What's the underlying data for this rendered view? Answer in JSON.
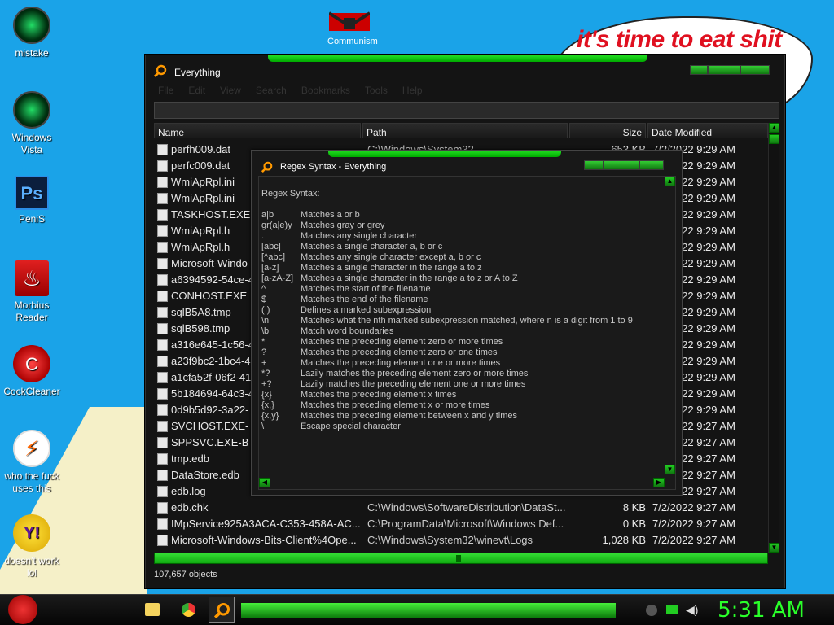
{
  "desktop": {
    "icons": [
      {
        "label": "mistake",
        "icon": "green-orb-icon"
      },
      {
        "label": "Windows Vista",
        "icon": "green-orb-icon"
      },
      {
        "label": "PeniS",
        "icon": "photoshop-icon"
      },
      {
        "label": "Morbius Reader",
        "icon": "pdf-reader-icon"
      },
      {
        "label": "CockCleaner",
        "icon": "cleaner-icon"
      },
      {
        "label": "who the fuck uses this",
        "icon": "lightning-icon"
      },
      {
        "label": "doesn't work lol",
        "icon": "yahoo-messenger-icon"
      }
    ],
    "top_icon_label": "Communism",
    "bubble_text": "it's time to eat shit"
  },
  "everything": {
    "title": "Everything",
    "menu": [
      "File",
      "Edit",
      "View",
      "Search",
      "Bookmarks",
      "Tools",
      "Help"
    ],
    "columns": [
      "Name",
      "Path",
      "Size",
      "Date Modified"
    ],
    "rows": [
      {
        "name": "perfh009.dat",
        "path": "C:\\Windows\\System32",
        "size": "653 KB",
        "date": "7/2/2022 9:29 AM"
      },
      {
        "name": "perfc009.dat",
        "path": "",
        "size": "",
        "date": "7/2/2022 9:29 AM"
      },
      {
        "name": "WmiApRpl.ini",
        "path": "",
        "size": "",
        "date": "7/2/2022 9:29 AM"
      },
      {
        "name": "WmiApRpl.ini",
        "path": "",
        "size": "",
        "date": "7/2/2022 9:29 AM"
      },
      {
        "name": "TASKHOST.EXE",
        "path": "",
        "size": "",
        "date": "7/2/2022 9:29 AM"
      },
      {
        "name": "WmiApRpl.h",
        "path": "",
        "size": "",
        "date": "7/2/2022 9:29 AM"
      },
      {
        "name": "WmiApRpl.h",
        "path": "",
        "size": "",
        "date": "7/2/2022 9:29 AM"
      },
      {
        "name": "Microsoft-Windo",
        "path": "",
        "size": "",
        "date": "7/2/2022 9:29 AM"
      },
      {
        "name": "a6394592-54ce-4",
        "path": "",
        "size": "",
        "date": "7/2/2022 9:29 AM"
      },
      {
        "name": "CONHOST.EXE",
        "path": "",
        "size": "",
        "date": "7/2/2022 9:29 AM"
      },
      {
        "name": "sqlB5A8.tmp",
        "path": "",
        "size": "",
        "date": "7/2/2022 9:29 AM"
      },
      {
        "name": "sqlB598.tmp",
        "path": "",
        "size": "",
        "date": "7/2/2022 9:29 AM"
      },
      {
        "name": "a316e645-1c56-4",
        "path": "",
        "size": "",
        "date": "7/2/2022 9:29 AM"
      },
      {
        "name": "a23f9bc2-1bc4-4",
        "path": "",
        "size": "",
        "date": "7/2/2022 9:29 AM"
      },
      {
        "name": "a1cfa52f-06f2-41",
        "path": "",
        "size": "",
        "date": "7/2/2022 9:29 AM"
      },
      {
        "name": "5b184694-64c3-4",
        "path": "",
        "size": "",
        "date": "7/2/2022 9:29 AM"
      },
      {
        "name": "0d9b5d92-3a22-",
        "path": "",
        "size": "",
        "date": "7/2/2022 9:29 AM"
      },
      {
        "name": "SVCHOST.EXE-",
        "path": "",
        "size": "",
        "date": "7/2/2022 9:27 AM"
      },
      {
        "name": "SPPSVC.EXE-B",
        "path": "",
        "size": "",
        "date": "7/2/2022 9:27 AM"
      },
      {
        "name": "tmp.edb",
        "path": "",
        "size": "",
        "date": "7/2/2022 9:27 AM"
      },
      {
        "name": "DataStore.edb",
        "path": "",
        "size": "",
        "date": "7/2/2022 9:27 AM"
      },
      {
        "name": "edb.log",
        "path": "",
        "size": "",
        "date": "7/2/2022 9:27 AM"
      },
      {
        "name": "edb.chk",
        "path": "C:\\Windows\\SoftwareDistribution\\DataSt...",
        "size": "8 KB",
        "date": "7/2/2022 9:27 AM"
      },
      {
        "name": "IMpService925A3ACA-C353-458A-AC...",
        "path": "C:\\ProgramData\\Microsoft\\Windows Def...",
        "size": "0 KB",
        "date": "7/2/2022 9:27 AM"
      },
      {
        "name": "Microsoft-Windows-Bits-Client%4Ope...",
        "path": "C:\\Windows\\System32\\winevt\\Logs",
        "size": "1,028 KB",
        "date": "7/2/2022 9:27 AM"
      }
    ],
    "status": "107,657 objects"
  },
  "regex_dialog": {
    "title": "Regex Syntax - Everything",
    "heading": "Regex Syntax:",
    "entries": [
      {
        "k": "a|b",
        "v": "Matches a or b"
      },
      {
        "k": "gr(a|e)y",
        "v": "Matches gray or grey"
      },
      {
        "k": ".",
        "v": "Matches any single character"
      },
      {
        "k": "[abc]",
        "v": "Matches a single character a, b or c"
      },
      {
        "k": "[^abc]",
        "v": "Matches any single character except a, b or c"
      },
      {
        "k": "[a-z]",
        "v": "Matches a single character in the range a to z"
      },
      {
        "k": "[a-zA-Z]",
        "v": "Matches a single character in the range a to z or A to Z"
      },
      {
        "k": "^",
        "v": "Matches the start of the filename"
      },
      {
        "k": "$",
        "v": "Matches the end of the filename"
      },
      {
        "k": "( )",
        "v": "Defines a marked subexpression"
      },
      {
        "k": "\\n",
        "v": "Matches what the nth marked subexpression matched, where n is a digit from 1 to 9"
      },
      {
        "k": "\\b",
        "v": "Match word boundaries"
      },
      {
        "k": "*",
        "v": "Matches the preceding element zero or more times"
      },
      {
        "k": "?",
        "v": "Matches the preceding element zero or one times"
      },
      {
        "k": "+",
        "v": "Matches the preceding element one or more times"
      },
      {
        "k": "*?",
        "v": "Lazily matches the preceding element zero or more times"
      },
      {
        "k": "+?",
        "v": "Lazily matches the preceding element one or more times"
      },
      {
        "k": "{x}",
        "v": "Matches the preceding element x times"
      },
      {
        "k": "{x,}",
        "v": "Matches the preceding element x or more times"
      },
      {
        "k": "{x,y}",
        "v": "Matches the preceding element between x and y times"
      },
      {
        "k": "\\",
        "v": "Escape special character"
      }
    ]
  },
  "taskbar": {
    "clock": "5:31 AM",
    "accent": "#2aff2a"
  }
}
